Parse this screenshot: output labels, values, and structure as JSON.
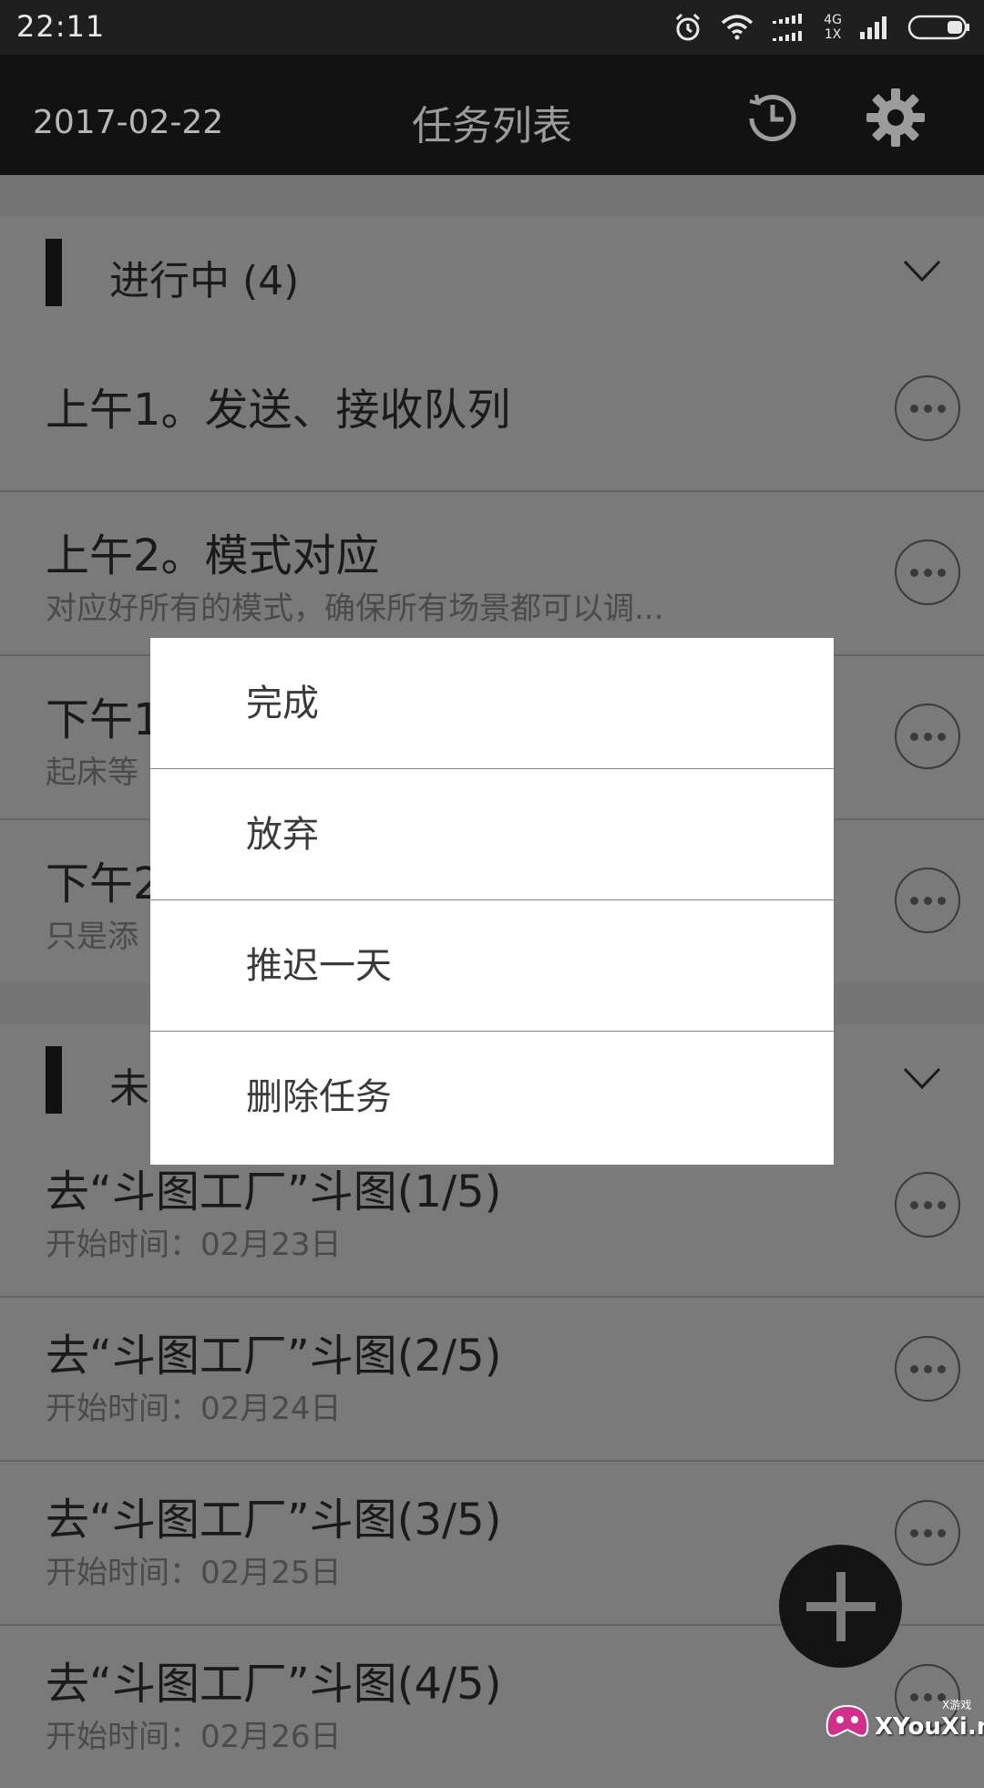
{
  "status_bar": {
    "time": "22:11",
    "net_top": "4G",
    "net_bottom": "1X"
  },
  "app_bar": {
    "date": "2017-02-22",
    "title": "任务列表"
  },
  "sections": [
    {
      "title": "进行中 (4)",
      "items": [
        {
          "title": "上午1。发送、接收队列",
          "subtitle": ""
        },
        {
          "title": "上午2。模式对应",
          "subtitle": "对应好所有的模式，确保所有场景都可以调..."
        },
        {
          "title": "下午1",
          "subtitle": "起床等"
        },
        {
          "title": "下午2",
          "subtitle": "只是添"
        }
      ]
    },
    {
      "title": "未",
      "items": [
        {
          "title": "去“斗图工厂”斗图(1/5)",
          "subtitle": "开始时间：02月23日"
        },
        {
          "title": "去“斗图工厂”斗图(2/5)",
          "subtitle": "开始时间：02月24日"
        },
        {
          "title": "去“斗图工厂”斗图(3/5)",
          "subtitle": "开始时间：02月25日"
        },
        {
          "title": "去“斗图工厂”斗图(4/5)",
          "subtitle": "开始时间：02月26日"
        }
      ]
    }
  ],
  "dialog": {
    "items": [
      "完成",
      "放弃",
      "推迟一天",
      "删除任务"
    ]
  },
  "watermark": {
    "text": "XYouXi.net",
    "small": "X游戏"
  },
  "colors": {
    "app_bar": "#121212",
    "overlay_bg": "#7a7a7a",
    "dialog_bg": "#ffffff",
    "fab": "#141414"
  }
}
